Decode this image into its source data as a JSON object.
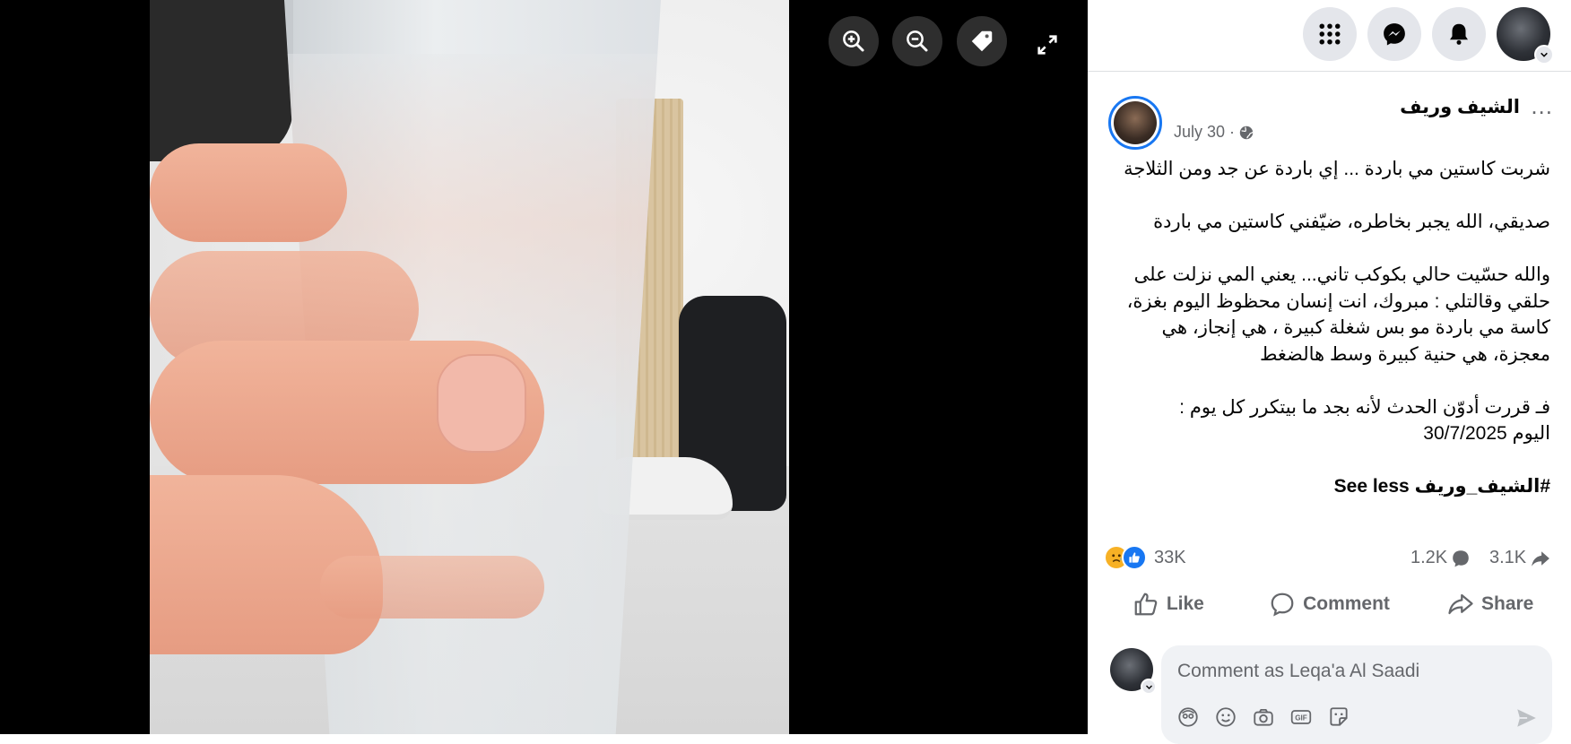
{
  "viewer": {
    "controls": [
      "zoom-in",
      "zoom-out",
      "tag",
      "fullscreen"
    ]
  },
  "topbar": {
    "icons": [
      "menu-grid-icon",
      "messenger-icon",
      "notifications-icon",
      "account-avatar"
    ]
  },
  "post": {
    "author": "الشيف وريف",
    "date": "July 30 ·",
    "privacy_icon": "globe-icon",
    "paragraphs": [
      "شربت كاستين مي باردة ... إي باردة عن جد ومن الثلاجة",
      "صديقي، الله يجبر بخاطره، ضيّفني كاستين مي باردة",
      "والله حسّيت حالي بكوكب تاني... يعني المي نزلت على حلقي وقالتلي : مبروك، انت إنسان محظوظ اليوم بغزة، كاسة مي باردة مو بس شغلة كبيرة ، هي إنجاز، هي معجزة، هي حنية كبيرة وسط هالضغط",
      "فـ قررت أدوّن الحدث لأنه بجد ما بيتكرر كل يوم :",
      "اليوم 30/7/2025"
    ],
    "hashtag": "#الشيف_وريف",
    "see_less": "See less"
  },
  "stats": {
    "reactions": "33K",
    "comments": "1.2K",
    "shares": "3.1K"
  },
  "actions": {
    "like": "Like",
    "comment": "Comment",
    "share": "Share"
  },
  "composer": {
    "placeholder": "Comment as Leqa'a Al Saadi"
  },
  "colors": {
    "accent": "#1877f2",
    "muted_text": "#65676b",
    "bubble_bg": "#f0f2f5",
    "viewer_bg": "#000000"
  }
}
